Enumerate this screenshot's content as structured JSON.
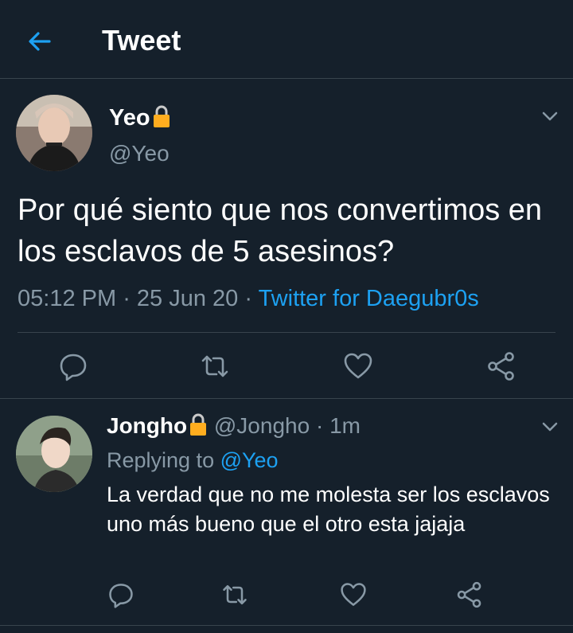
{
  "header": {
    "title": "Tweet"
  },
  "tweet": {
    "name": "Yeo",
    "handle": "@Yeo",
    "text": "Por qué siento que nos convertimos en los esclavos de 5 asesinos?",
    "time": "05:12 PM",
    "sep1": " · ",
    "date": "25 Jun 20",
    "sep2": " · ",
    "source": "Twitter for Daegubr0s"
  },
  "reply": {
    "name": "Jongho",
    "handle": "@Jongho",
    "dot": " · ",
    "age": "1m",
    "replying_prefix": "Replying to ",
    "replying_to": "@Yeo",
    "text": "La verdad que no me molesta ser los esclavos uno más bueno que el otro esta jajaja"
  },
  "colors": {
    "background": "#15202b",
    "accent": "#1da1f2",
    "secondary_text": "#8899a6",
    "divider": "#38444d",
    "lock": "#ffad1f"
  },
  "icons": [
    "arrow-left-icon",
    "lock-icon",
    "chevron-down-icon",
    "reply-icon",
    "retweet-icon",
    "like-icon",
    "share-icon"
  ]
}
